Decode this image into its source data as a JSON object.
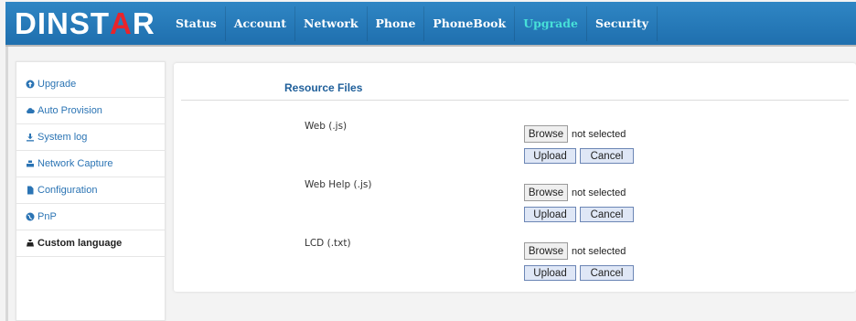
{
  "brand": {
    "logo_before": "DINST",
    "logo_accent": "A",
    "logo_after": "R"
  },
  "nav": {
    "items": [
      "Status",
      "Account",
      "Network",
      "Phone",
      "PhoneBook",
      "Upgrade",
      "Security"
    ],
    "active": "Upgrade"
  },
  "sidebar": {
    "items": [
      {
        "label": "Upgrade",
        "icon": "upgrade-circle-icon"
      },
      {
        "label": "Auto Provision",
        "icon": "cloud-icon"
      },
      {
        "label": "System log",
        "icon": "download-icon"
      },
      {
        "label": "Network Capture",
        "icon": "network-icon"
      },
      {
        "label": "Configuration",
        "icon": "file-icon"
      },
      {
        "label": "PnP",
        "icon": "globe-icon"
      },
      {
        "label": "Custom language",
        "icon": "language-icon"
      }
    ],
    "active": "Custom language"
  },
  "main": {
    "section_title": "Resource Files",
    "rows": [
      {
        "label": "Web (.js)",
        "browse": "Browse",
        "status": "not selected",
        "upload": "Upload",
        "cancel": "Cancel"
      },
      {
        "label": "Web Help (.js)",
        "browse": "Browse",
        "status": "not selected",
        "upload": "Upload",
        "cancel": "Cancel"
      },
      {
        "label": "LCD (.txt)",
        "browse": "Browse",
        "status": "not selected",
        "upload": "Upload",
        "cancel": "Cancel"
      }
    ]
  },
  "colors": {
    "header": "#2179b8",
    "active_nav": "#47e0d8",
    "link": "#2b74b4",
    "title": "#1f5f9a",
    "logo_accent": "#e8242b"
  }
}
